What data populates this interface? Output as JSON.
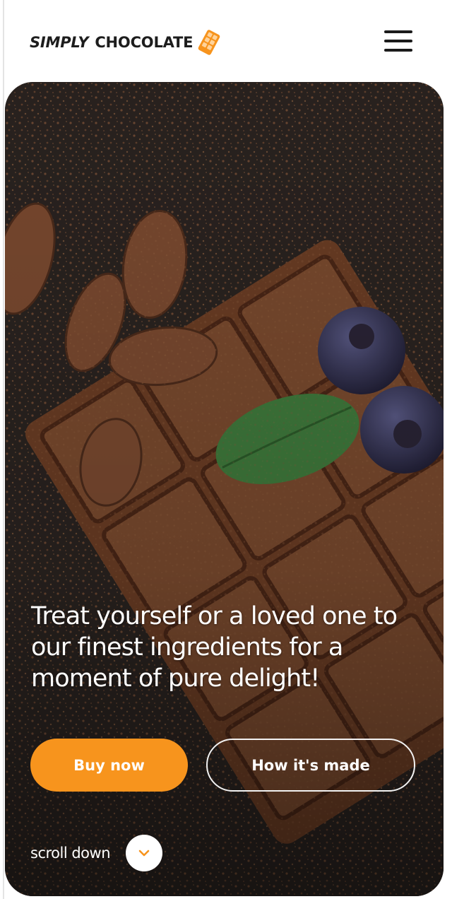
{
  "header": {
    "logo_word1": "SIMPLY",
    "logo_word2": "CHOCOLATE",
    "logo_icon": "chocolate-bar-icon",
    "menu_icon": "hamburger-menu-icon"
  },
  "hero": {
    "title": "Treat yourself or a loved one to our finest ingredients for a moment of pure delight!",
    "buy_label": "Buy now",
    "how_label": "How it's made",
    "scroll_label": "scroll down",
    "scroll_icon": "chevron-down-icon"
  },
  "colors": {
    "accent": "#f7941d",
    "text_dark": "#1d1d1d",
    "hero_bg": "#241e1b"
  }
}
